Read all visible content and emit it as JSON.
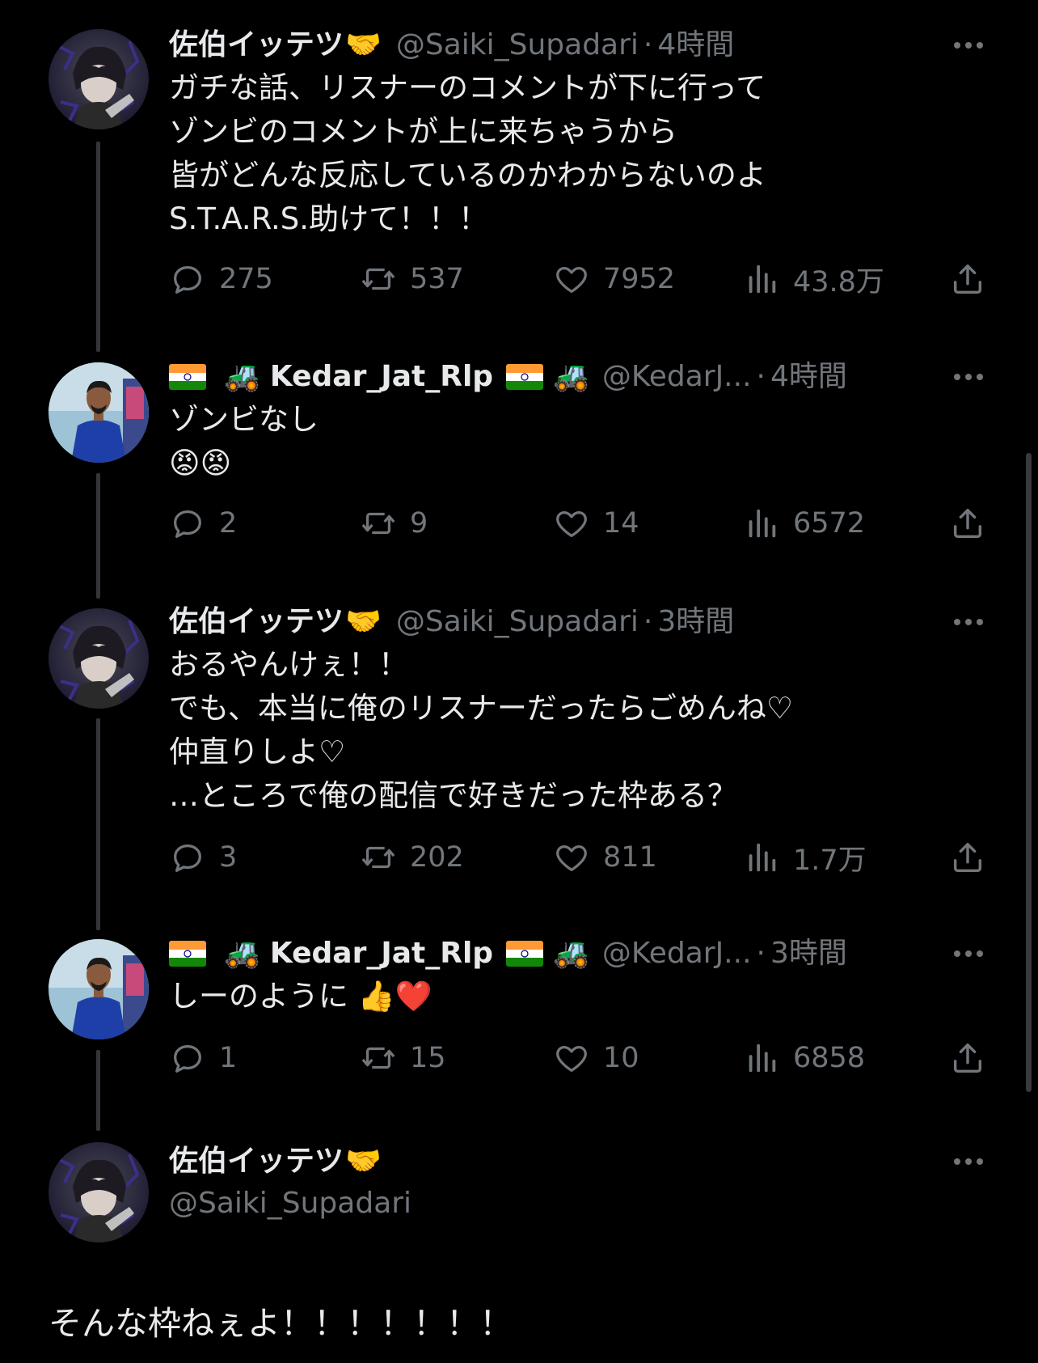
{
  "tweets": [
    {
      "name": "佐伯イッテツ",
      "name_emoji": "🤝",
      "handle": "@Saiki_Supadari",
      "dot": "·",
      "time": "4時間",
      "text": "ガチな話、リスナーのコメントが下に行って\nゾンビのコメントが上に来ちゃうから\n皆がどんな反応しているのかわからないのよ\nS.T.A.R.S.助けて！！！",
      "replies": "275",
      "retweets": "537",
      "likes": "7952",
      "views": "43.8万"
    },
    {
      "name": "Kedar_Jat_Rlp",
      "name_emoji": "🚜",
      "handle": "@KedarJ...",
      "dot": "·",
      "time": "4時間",
      "text": "ゾンビなし\n😡😡",
      "replies": "2",
      "retweets": "9",
      "likes": "14",
      "views": "6572"
    },
    {
      "name": "佐伯イッテツ",
      "name_emoji": "🤝",
      "handle": "@Saiki_Supadari",
      "dot": "·",
      "time": "3時間",
      "text": "おるやんけぇ！！\nでも、本当に俺のリスナーだったらごめんね♡\n仲直りしよ♡\n…ところで俺の配信で好きだった枠ある？",
      "replies": "3",
      "retweets": "202",
      "likes": "811",
      "views": "1.7万"
    },
    {
      "name": "Kedar_Jat_Rlp",
      "name_emoji": "🚜",
      "handle": "@KedarJ...",
      "dot": "·",
      "time": "3時間",
      "text": "しーのように 👍❤️",
      "replies": "1",
      "retweets": "15",
      "likes": "10",
      "views": "6858"
    }
  ],
  "main_tweet": {
    "name": "佐伯イッテツ",
    "name_emoji": "🤝",
    "handle": "@Saiki_Supadari",
    "text": "そんな枠ねぇよ！！！！！！！"
  },
  "icons": {
    "reply": "reply-icon",
    "retweet": "retweet-icon",
    "like": "heart-icon",
    "views": "views-icon",
    "share": "share-icon",
    "more": "more-icon"
  },
  "colors": {
    "background": "#000000",
    "text_primary": "#e7e9ea",
    "text_secondary": "#71767b",
    "thread_line": "#333639"
  }
}
